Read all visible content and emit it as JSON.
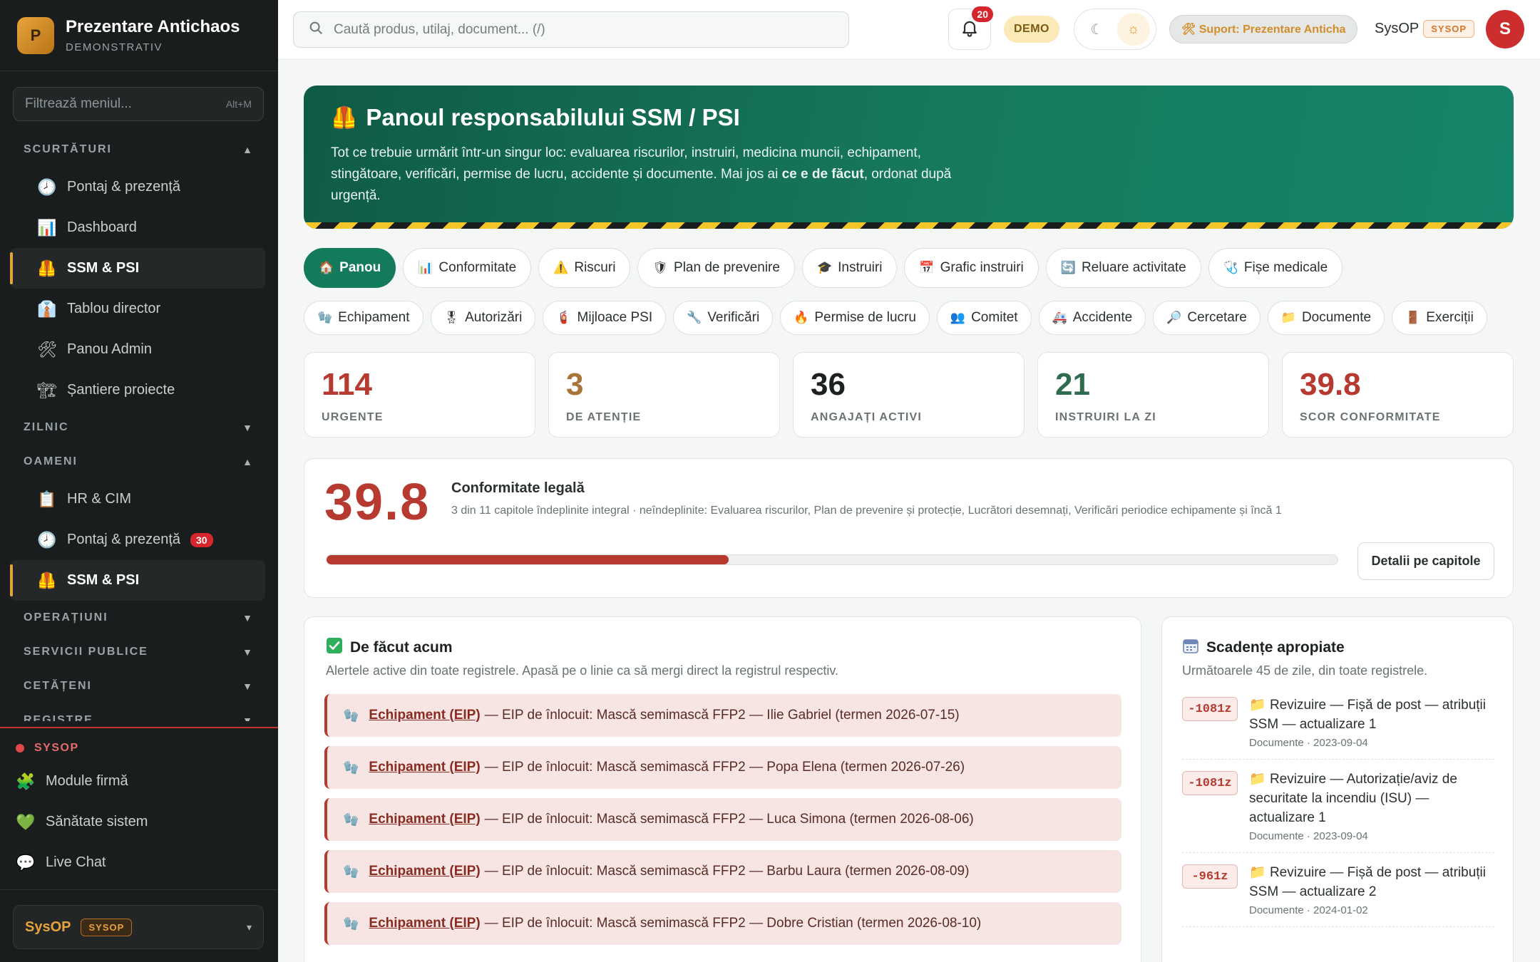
{
  "brand": {
    "initial": "P",
    "name": "Prezentare Antichaos",
    "subtitle": "DEMONSTRATIV"
  },
  "menu_filter": {
    "placeholder": "Filtrează meniul...",
    "shortcut": "Alt+M"
  },
  "sidebar": {
    "sections": [
      {
        "label": "SCURTĂTURI",
        "state": "expanded",
        "items": [
          {
            "icon": "clock-icon",
            "glyph": "🕗",
            "label": "Pontaj & prezență"
          },
          {
            "icon": "chart-icon",
            "glyph": "📊",
            "label": "Dashboard"
          },
          {
            "icon": "vest-icon",
            "glyph": "🦺",
            "label": "SSM & PSI",
            "active": true
          },
          {
            "icon": "board-icon",
            "glyph": "👔",
            "label": "Tablou director"
          },
          {
            "icon": "tools-icon",
            "glyph": "🛠",
            "label": "Panou Admin"
          },
          {
            "icon": "crane-icon",
            "glyph": "🏗",
            "label": "Șantiere proiecte"
          }
        ]
      },
      {
        "label": "ZILNIC",
        "state": "collapsed"
      },
      {
        "label": "OAMENI",
        "state": "expanded",
        "items": [
          {
            "icon": "clipboard-icon",
            "glyph": "📋",
            "label": "HR & CIM"
          },
          {
            "icon": "clock-icon",
            "glyph": "🕗",
            "label": "Pontaj & prezență",
            "badge": "30"
          },
          {
            "icon": "vest-icon",
            "glyph": "🦺",
            "label": "SSM & PSI",
            "active": true
          }
        ]
      },
      {
        "label": "OPERAȚIUNI",
        "state": "collapsed"
      },
      {
        "label": "SERVICII PUBLICE",
        "state": "collapsed"
      },
      {
        "label": "CETĂȚENI",
        "state": "collapsed"
      },
      {
        "label": "REGISTRE",
        "state": "collapsed"
      }
    ],
    "sysop": {
      "title": "SYSOP",
      "items": [
        {
          "icon": "puzzle-icon",
          "glyph": "🧩",
          "label": "Module firmă"
        },
        {
          "icon": "heart-icon",
          "glyph": "💚",
          "label": "Sănătate sistem"
        },
        {
          "icon": "chat-bubble-icon",
          "glyph": "💬",
          "label": "Live Chat"
        }
      ]
    },
    "user": {
      "name": "SysOP",
      "role": "SYSOP"
    }
  },
  "topbar": {
    "search_placeholder": "Caută produs, utilaj, document... (/)",
    "notifications": "20",
    "demo_label": "DEMO",
    "support_label": "🛠 Suport: Prezentare Anticha",
    "user_name": "SysOP",
    "user_role": "SYSOP",
    "avatar_initial": "S"
  },
  "hero": {
    "icon": "🦺",
    "title": "Panoul responsabilului SSM / PSI",
    "text_before": "Tot ce trebuie urmărit într-un singur loc: evaluarea riscurilor, instruiri, medicina muncii, echipament, stingătoare, verificări, permise de lucru, accidente și documente. Mai jos ai ",
    "text_bold": "ce e de făcut",
    "text_after": ", ordonat după urgență."
  },
  "tabs_row1": [
    {
      "glyph": "🏠",
      "icon": "home-icon",
      "label": "Panou",
      "active": true
    },
    {
      "glyph": "📊",
      "icon": "chart-icon",
      "label": "Conformitate"
    },
    {
      "glyph": "⚠️",
      "icon": "warning-icon",
      "label": "Riscuri"
    },
    {
      "glyph": "🛡",
      "icon": "shield-icon",
      "label": "Plan de prevenire"
    },
    {
      "glyph": "🎓",
      "icon": "graduation-icon",
      "label": "Instruiri"
    },
    {
      "glyph": "📅",
      "icon": "calendar-icon",
      "label": "Grafic instruiri"
    },
    {
      "glyph": "🔄",
      "icon": "refresh-icon",
      "label": "Reluare activitate"
    },
    {
      "glyph": "🩺",
      "icon": "stethoscope-icon",
      "label": "Fișe medicale"
    }
  ],
  "tabs_row2": [
    {
      "glyph": "🧤",
      "icon": "glove-icon",
      "label": "Echipament"
    },
    {
      "glyph": "🎖",
      "icon": "medal-icon",
      "label": "Autorizări"
    },
    {
      "glyph": "🧯",
      "icon": "extinguisher-icon",
      "label": "Mijloace PSI"
    },
    {
      "glyph": "🔧",
      "icon": "wrench-icon",
      "label": "Verificări"
    },
    {
      "glyph": "🔥",
      "icon": "fire-icon",
      "label": "Permise de lucru"
    },
    {
      "glyph": "👥",
      "icon": "people-icon",
      "label": "Comitet"
    },
    {
      "glyph": "🚑",
      "icon": "ambulance-icon",
      "label": "Accidente"
    },
    {
      "glyph": "🔎",
      "icon": "magnifier-icon",
      "label": "Cercetare"
    },
    {
      "glyph": "📁",
      "icon": "folder-icon",
      "label": "Documente"
    },
    {
      "glyph": "🚪",
      "icon": "door-icon",
      "label": "Exerciții"
    }
  ],
  "stats": [
    {
      "value": "114",
      "label": "URGENTE",
      "color": "#b73a30"
    },
    {
      "value": "3",
      "label": "DE ATENȚIE",
      "color": "#a8743a"
    },
    {
      "value": "36",
      "label": "ANGAJAȚI ACTIVI",
      "color": "#1d2121"
    },
    {
      "value": "21",
      "label": "INSTRUIRI LA ZI",
      "color": "#2f6b4e"
    },
    {
      "value": "39.8",
      "label": "SCOR CONFORMITATE",
      "color": "#b73a30"
    }
  ],
  "compliance": {
    "score": "39.8",
    "title": "Conformitate legală",
    "subtitle": "3 din 11 capitole îndeplinite integral · neîndeplinite: Evaluarea riscurilor, Plan de prevenire și protecție, Lucrători desemnați, Verificări periodice echipamente și încă 1",
    "progress": 0.398,
    "button": "Detalii pe capitole"
  },
  "todo": {
    "title": "De făcut acum",
    "subtitle": "Alertele active din toate registrele. Apasă pe o linie ca să mergi direct la registrul respectiv.",
    "alerts": [
      {
        "source": "Echipament (EIP)",
        "text": "— EIP de înlocuit: Mască semimască FFP2 — Ilie Gabriel (termen 2026-07-15)"
      },
      {
        "source": "Echipament (EIP)",
        "text": "— EIP de înlocuit: Mască semimască FFP2 — Popa Elena (termen 2026-07-26)"
      },
      {
        "source": "Echipament (EIP)",
        "text": "— EIP de înlocuit: Mască semimască FFP2 — Luca Simona (termen 2026-08-06)"
      },
      {
        "source": "Echipament (EIP)",
        "text": "— EIP de înlocuit: Mască semimască FFP2 — Barbu Laura (termen 2026-08-09)"
      },
      {
        "source": "Echipament (EIP)",
        "text": "— EIP de înlocuit: Mască semimască FFP2 — Dobre Cristian (termen 2026-08-10)"
      }
    ]
  },
  "deadlines": {
    "title": "Scadențe apropiate",
    "subtitle": "Următoarele 45 de zile, din toate registrele.",
    "items": [
      {
        "days": "-1081z",
        "title": "Revizuire — Fișă de post — atribuții SSM — actualizare 1",
        "meta": "Documente · 2023-09-04"
      },
      {
        "days": "-1081z",
        "title": "Revizuire — Autorizație/aviz de securitate la incendiu (ISU) — actualizare 1",
        "meta": "Documente · 2023-09-04"
      },
      {
        "days": "-961z",
        "title": "Revizuire — Fișă de post — atribuții SSM — actualizare 2",
        "meta": "Documente · 2024-01-02"
      }
    ]
  }
}
